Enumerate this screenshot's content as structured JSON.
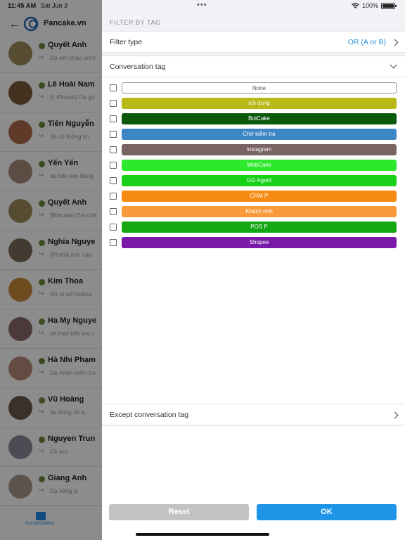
{
  "status": {
    "time": "11:45 AM",
    "date": "Sat Jun 3",
    "battery": "100%"
  },
  "app": {
    "name": "Pancake.vn"
  },
  "conversations": [
    {
      "name": "Quyết Anh",
      "preview": "Dạ em chào anh/",
      "avatar_color": "#9c8a5a"
    },
    {
      "name": "Lê Hoài Nam",
      "preview": "[4 Photos] Dạ gử",
      "avatar_color": "#7a5a3a"
    },
    {
      "name": "Tiên Nguyễn",
      "preview": "dạ có thông tin",
      "avatar_color": "#b06a4a"
    },
    {
      "name": "Yến Yến",
      "preview": "dạ bên em đang",
      "avatar_color": "#a88a7a"
    },
    {
      "name": "Quyết Anh",
      "preview": "[Botcake] Em chà",
      "avatar_color": "#9c8a5a"
    },
    {
      "name": "Nghia Nguye",
      "preview": "[Photo] anh vào",
      "avatar_color": "#7a6a5a"
    },
    {
      "name": "Kim Thoa",
      "preview": "chị ơi số hotline",
      "avatar_color": "#c8893a"
    },
    {
      "name": "Ha My Nguye",
      "preview": "và mail bên em c",
      "avatar_color": "#8a6a6a"
    },
    {
      "name": "Hà Nhi Phạm",
      "preview": "Dạ mình kiểm tra",
      "avatar_color": "#b88a7a"
    },
    {
      "name": "Vũ Hoàng",
      "preview": "dạ đúng rồi ạ",
      "avatar_color": "#6a5a4a"
    },
    {
      "name": "Nguyen Trun",
      "preview": "Ok em",
      "avatar_color": "#8a8a9a"
    },
    {
      "name": "Giang Anh",
      "preview": "Dạ vâng ạ",
      "avatar_color": "#a89a8a"
    }
  ],
  "bottom_tab": {
    "label": "Conversation"
  },
  "panel": {
    "title": "FILTER BY TAG",
    "filter_type_label": "Filter type",
    "filter_type_value": "OR (A or B)",
    "conversation_tag_label": "Conversation tag",
    "except_tag_label": "Except conversation tag",
    "reset_label": "Reset",
    "ok_label": "OK"
  },
  "tags": [
    {
      "label": "None",
      "color": "#ffffff",
      "text_color": "#555555",
      "border": "#999999"
    },
    {
      "label": "nội dung",
      "color": "#b8b817",
      "text_color": "#ffffff"
    },
    {
      "label": "BotCake",
      "color": "#0b5a0b",
      "text_color": "#ffffff"
    },
    {
      "label": "Chờ kiểm tra",
      "color": "#3d86c6",
      "text_color": "#ffffff"
    },
    {
      "label": "Instagram",
      "color": "#7a6363",
      "text_color": "#ffffff"
    },
    {
      "label": "WebCake",
      "color": "#2ee82e",
      "text_color": "#ffffff"
    },
    {
      "label": "GG Agent",
      "color": "#17d017",
      "text_color": "#ffffff"
    },
    {
      "label": "CRM P",
      "color": "#f58b12",
      "text_color": "#ffffff"
    },
    {
      "label": "Khách mới",
      "color": "#f99a3a",
      "text_color": "#ffffff"
    },
    {
      "label": "POS P",
      "color": "#14a814",
      "text_color": "#ffffff"
    },
    {
      "label": "Shopee",
      "color": "#7a1aa8",
      "text_color": "#ffffff"
    }
  ]
}
